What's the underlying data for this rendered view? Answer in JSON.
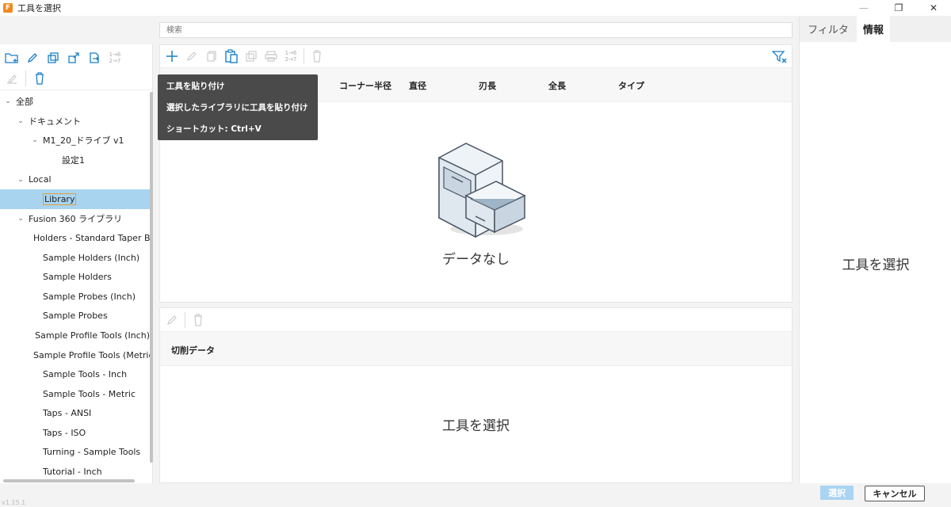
{
  "window": {
    "app_icon_letter": "F",
    "title": "工具を選択",
    "minimize": "—",
    "restore": "❐",
    "close": "✕"
  },
  "search": {
    "placeholder": "検索"
  },
  "left_toolbar": {
    "range_label": "1→6\n2→7"
  },
  "tree": {
    "items": [
      {
        "label": "全部",
        "indent": 0,
        "chevron": "⌄"
      },
      {
        "label": "ドキュメント",
        "indent": 1,
        "chevron": "⌄"
      },
      {
        "label": "M1_20_ドライブ v1",
        "indent": 2,
        "chevron": "⌄"
      },
      {
        "label": "設定1",
        "indent": 3,
        "chevron": ""
      },
      {
        "label": "Local",
        "indent": 1,
        "chevron": "⌄"
      },
      {
        "label": "Library",
        "indent": 2,
        "chevron": "",
        "selected": true
      },
      {
        "label": "Fusion 360 ライブラリ",
        "indent": 1,
        "chevron": "⌄"
      },
      {
        "label": "Holders - Standard Taper Bla",
        "indent": 2,
        "chevron": ""
      },
      {
        "label": "Sample Holders (Inch)",
        "indent": 2,
        "chevron": ""
      },
      {
        "label": "Sample Holders",
        "indent": 2,
        "chevron": ""
      },
      {
        "label": "Sample Probes (Inch)",
        "indent": 2,
        "chevron": ""
      },
      {
        "label": "Sample Probes",
        "indent": 2,
        "chevron": ""
      },
      {
        "label": "Sample Profile Tools (Inch)",
        "indent": 2,
        "chevron": ""
      },
      {
        "label": "Sample Profile Tools (Metric)",
        "indent": 2,
        "chevron": ""
      },
      {
        "label": "Sample Tools - Inch",
        "indent": 2,
        "chevron": ""
      },
      {
        "label": "Sample Tools - Metric",
        "indent": 2,
        "chevron": ""
      },
      {
        "label": "Taps - ANSI",
        "indent": 2,
        "chevron": ""
      },
      {
        "label": "Taps - ISO",
        "indent": 2,
        "chevron": ""
      },
      {
        "label": "Turning - Sample Tools",
        "indent": 2,
        "chevron": ""
      },
      {
        "label": "Tutorial - Inch",
        "indent": 2,
        "chevron": ""
      }
    ]
  },
  "main": {
    "range_label": "1→6\n2→7",
    "columns": [
      "コーナー半径",
      "直径",
      "刃長",
      "全長",
      "タイプ"
    ],
    "empty_text": "データなし"
  },
  "tooltip": {
    "line1": "工具を貼り付け",
    "line2": "選択したライブラリに工具を貼り付け",
    "line3": "ショートカット: Ctrl+V"
  },
  "cutting": {
    "header": "切削データ",
    "empty_text": "工具を選択"
  },
  "right": {
    "tabs": [
      "フィルタ",
      "情報"
    ],
    "empty_text": "工具を選択"
  },
  "footer": {
    "version": "v1.15.1",
    "select_button": "選択",
    "cancel_button": "キャンセル"
  }
}
